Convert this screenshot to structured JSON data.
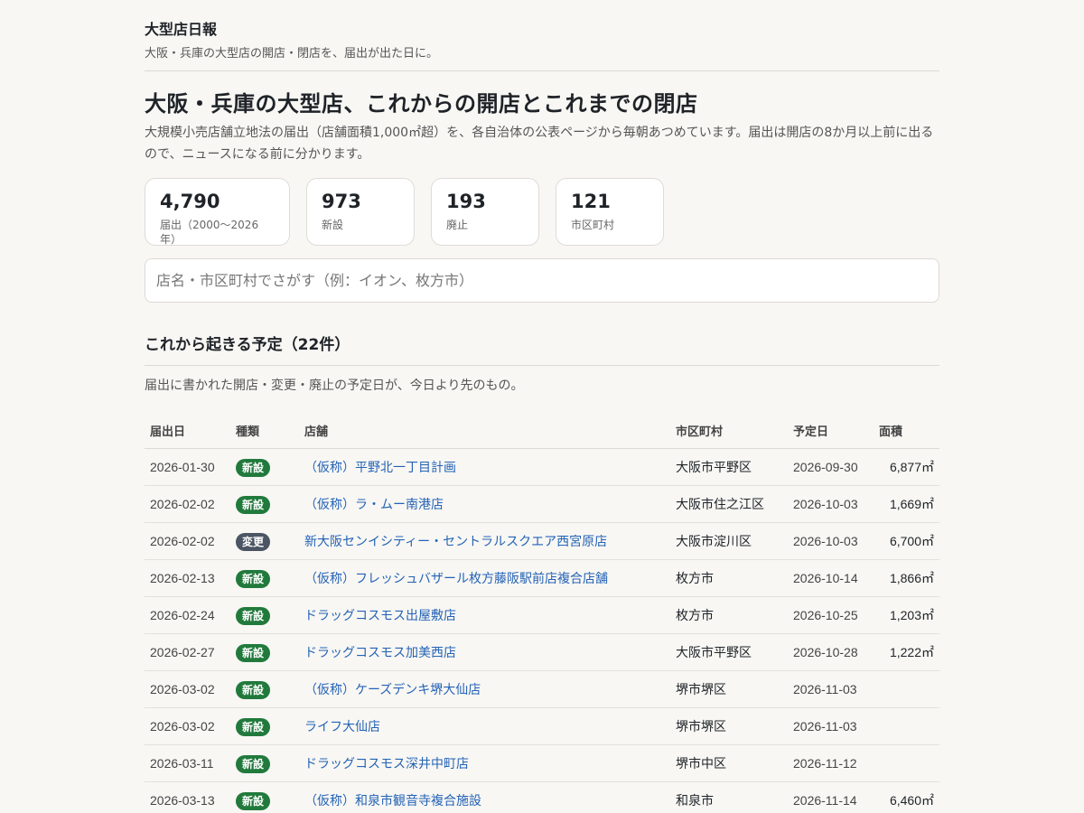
{
  "site": {
    "title": "大型店日報",
    "tagline": "大阪・兵庫の大型店の開店・閉店を、届出が出た日に。"
  },
  "page": {
    "title": "大阪・兵庫の大型店、これからの開店とこれまでの閉店",
    "lead": "大規模小売店舗立地法の届出（店舗面積1,000㎡超）を、各自治体の公表ページから毎朝あつめています。届出は開店の8か月以上前に出るので、ニュースになる前に分かります。"
  },
  "stats": [
    {
      "value": "4,790",
      "label": "届出（2000〜2026年）"
    },
    {
      "value": "973",
      "label": "新設"
    },
    {
      "value": "193",
      "label": "廃止"
    },
    {
      "value": "121",
      "label": "市区町村"
    }
  ],
  "search": {
    "placeholder": "店名・市区町村でさがす（例：イオン、枚方市）",
    "value": ""
  },
  "upcoming": {
    "title": "これから起きる予定（22件）",
    "description": "届出に書かれた開店・変更・廃止の予定日が、今日より先のもの。",
    "columns": [
      "届出日",
      "種類",
      "店舗",
      "市区町村",
      "予定日",
      "面積"
    ],
    "rows": [
      {
        "filed": "2026-01-30",
        "type": "新設",
        "store": "（仮称）平野北一丁目計画",
        "city": "大阪市平野区",
        "planned": "2026-09-30",
        "area": "6,877㎡"
      },
      {
        "filed": "2026-02-02",
        "type": "新設",
        "store": "（仮称）ラ・ムー南港店",
        "city": "大阪市住之江区",
        "planned": "2026-10-03",
        "area": "1,669㎡"
      },
      {
        "filed": "2026-02-02",
        "type": "変更",
        "store": "新大阪センイシティー・セントラルスクエア西宮原店",
        "city": "大阪市淀川区",
        "planned": "2026-10-03",
        "area": "6,700㎡"
      },
      {
        "filed": "2026-02-13",
        "type": "新設",
        "store": "（仮称）フレッシュバザール枚方藤阪駅前店複合店舗",
        "city": "枚方市",
        "planned": "2026-10-14",
        "area": "1,866㎡"
      },
      {
        "filed": "2026-02-24",
        "type": "新設",
        "store": "ドラッグコスモス出屋敷店",
        "city": "枚方市",
        "planned": "2026-10-25",
        "area": "1,203㎡"
      },
      {
        "filed": "2026-02-27",
        "type": "新設",
        "store": "ドラッグコスモス加美西店",
        "city": "大阪市平野区",
        "planned": "2026-10-28",
        "area": "1,222㎡"
      },
      {
        "filed": "2026-03-02",
        "type": "新設",
        "store": "（仮称）ケーズデンキ堺大仙店",
        "city": "堺市堺区",
        "planned": "2026-11-03",
        "area": ""
      },
      {
        "filed": "2026-03-02",
        "type": "新設",
        "store": "ライフ大仙店",
        "city": "堺市堺区",
        "planned": "2026-11-03",
        "area": ""
      },
      {
        "filed": "2026-03-11",
        "type": "新設",
        "store": "ドラッグコスモス深井中町店",
        "city": "堺市中区",
        "planned": "2026-11-12",
        "area": ""
      },
      {
        "filed": "2026-03-13",
        "type": "新設",
        "store": "（仮称）和泉市観音寺複合施設",
        "city": "和泉市",
        "planned": "2026-11-14",
        "area": "6,460㎡"
      }
    ]
  },
  "colors": {
    "page_bg": "#f8f7f4",
    "badge_new": "#217a3c",
    "badge_change": "#4b5563",
    "link": "#2563b5"
  }
}
